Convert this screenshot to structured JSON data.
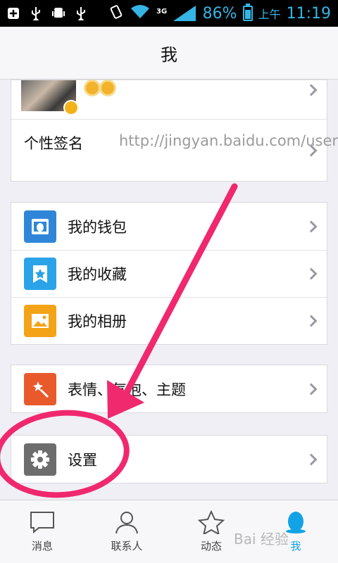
{
  "status_bar": {
    "network_label": "3G",
    "battery_percent": "86%",
    "am_pm": "上午",
    "time": "11:19"
  },
  "header": {
    "title": "我"
  },
  "profile": {
    "signature_label": "个性签名",
    "signature_value": "http://jingyan.baidu.com/user…"
  },
  "menu_group_1": {
    "items": [
      {
        "label": "我的钱包",
        "icon": "wallet-icon",
        "color": "#2f86d8"
      },
      {
        "label": "我的收藏",
        "icon": "favorites-star-icon",
        "color": "#2aa3e8"
      },
      {
        "label": "我的相册",
        "icon": "photo-album-icon",
        "color": "#f4a316"
      }
    ]
  },
  "menu_group_2": {
    "items": [
      {
        "label": "表情、气泡、主题",
        "icon": "magic-wand-icon",
        "color": "#e85a2c"
      }
    ]
  },
  "menu_group_3": {
    "items": [
      {
        "label": "设置",
        "icon": "gear-icon",
        "color": "#6d6d6d"
      }
    ]
  },
  "tabs": [
    {
      "label": "消息",
      "icon": "message-icon",
      "active": false
    },
    {
      "label": "联系人",
      "icon": "contacts-icon",
      "active": false
    },
    {
      "label": "动态",
      "icon": "star-icon",
      "active": false
    },
    {
      "label": "我",
      "icon": "penguin-icon",
      "active": true
    }
  ],
  "annotation": {
    "color": "#f0286e",
    "watermark": "Bai 经验"
  }
}
